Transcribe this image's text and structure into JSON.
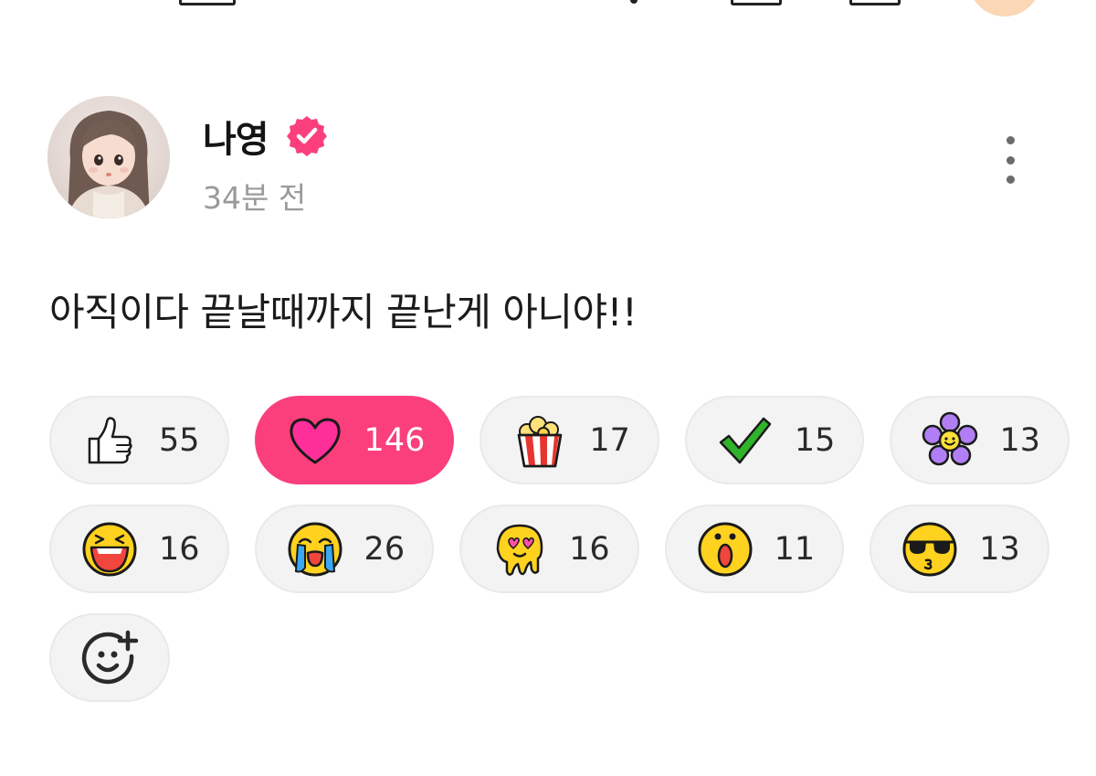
{
  "post": {
    "author": "나영",
    "time_ago": "34분 전",
    "text": "아직이다 끝날때까지 끝난게 아니야!!"
  },
  "reactions": {
    "row1": [
      {
        "icon": "thumbs-up-icon",
        "count": "55",
        "active": false
      },
      {
        "icon": "heart-icon",
        "count": "146",
        "active": true
      },
      {
        "icon": "popcorn-icon",
        "count": "17",
        "active": false
      },
      {
        "icon": "check-icon",
        "count": "15",
        "active": false
      },
      {
        "icon": "flower-icon",
        "count": "13",
        "active": false
      }
    ],
    "row2": [
      {
        "icon": "laughing-face-icon",
        "count": "16",
        "active": false
      },
      {
        "icon": "crying-face-icon",
        "count": "26",
        "active": false
      },
      {
        "icon": "heart-eyes-melting-face-icon",
        "count": "16",
        "active": false
      },
      {
        "icon": "shocked-face-icon",
        "count": "11",
        "active": false
      },
      {
        "icon": "sunglasses-face-icon",
        "count": "13",
        "active": false
      }
    ],
    "add_icon": "add-reaction-icon"
  },
  "colors": {
    "accent": "#fb3f7c",
    "chip_bg": "#f3f3f4",
    "muted_text": "#9a9a9a"
  }
}
